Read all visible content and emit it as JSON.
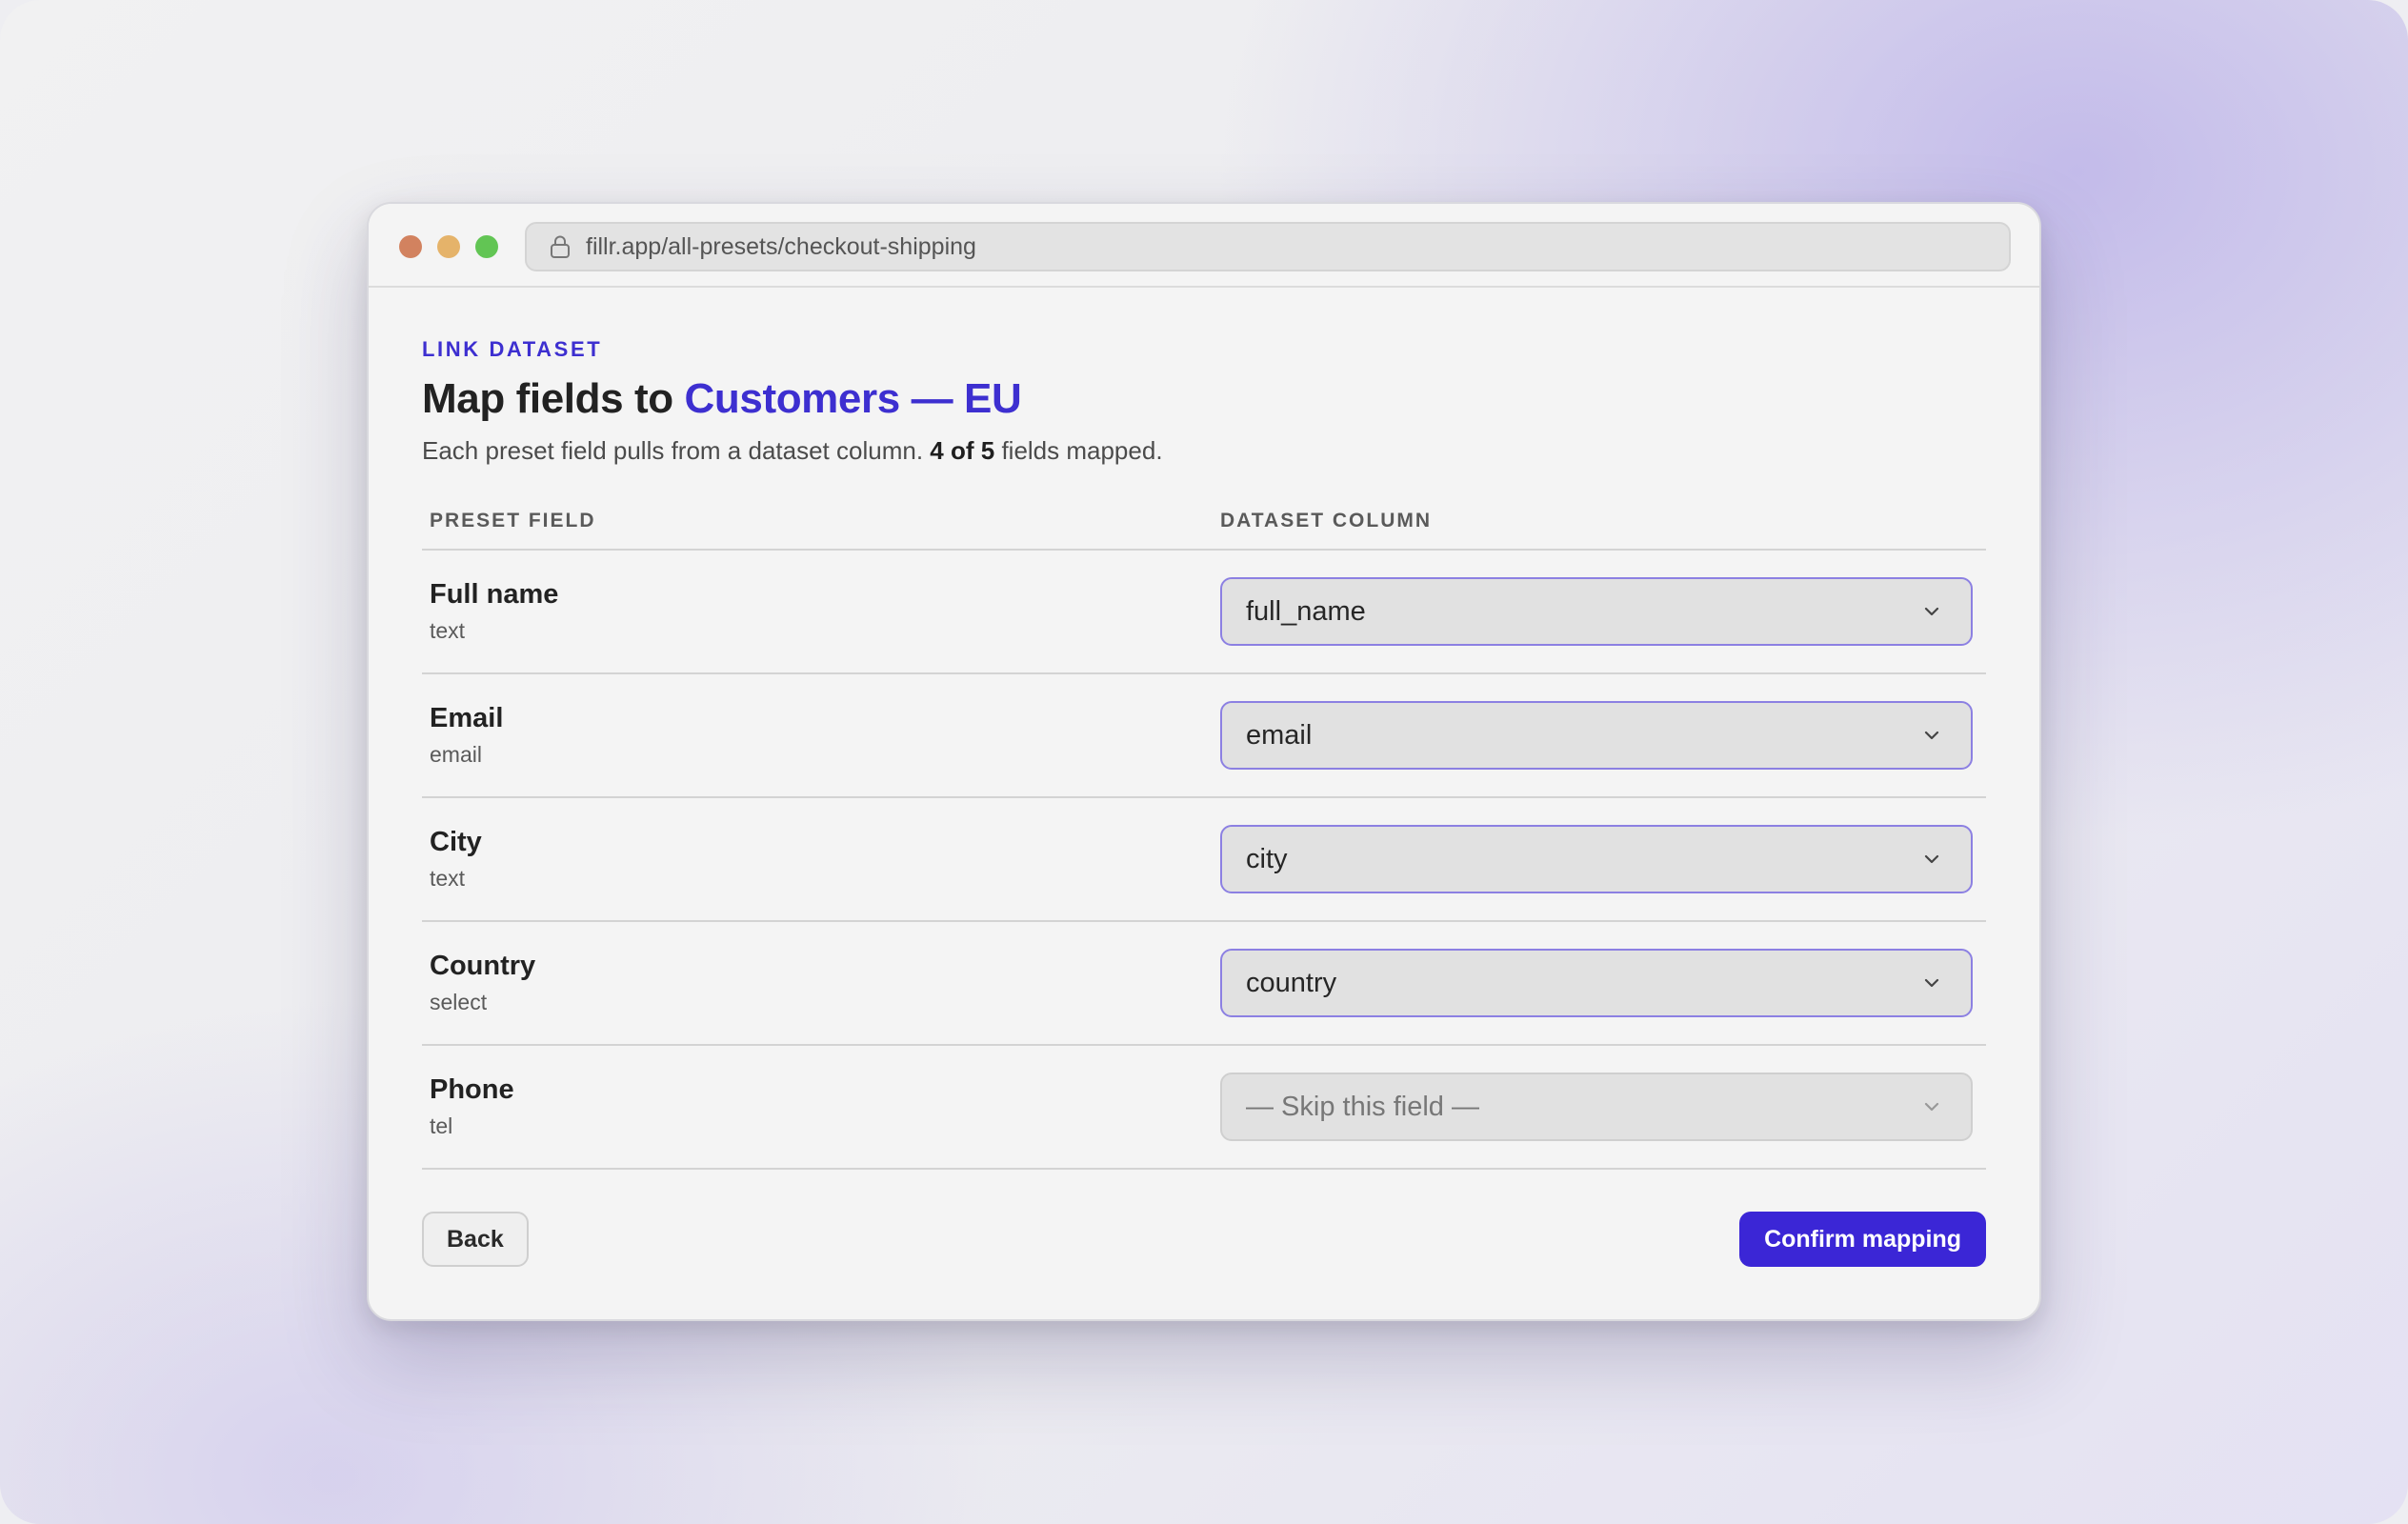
{
  "browser": {
    "url": "fillr.app/all-presets/checkout-shipping",
    "icon": "lock-icon"
  },
  "page": {
    "eyebrow": "LINK DATASET",
    "title_prefix": "Map fields to",
    "dataset_name": "Customers — EU",
    "subtitle_prefix": "Each preset field pulls from a dataset column.",
    "mapped_count": "4 of 5",
    "subtitle_suffix": "fields mapped."
  },
  "table": {
    "headers": [
      "PRESET FIELD",
      "DATASET COLUMN"
    ],
    "rows": [
      {
        "field": "Full name",
        "type": "text",
        "column": "full_name"
      },
      {
        "field": "Email",
        "type": "email",
        "column": "email"
      },
      {
        "field": "City",
        "type": "text",
        "column": "city"
      },
      {
        "field": "Country",
        "type": "select",
        "column": "country"
      },
      {
        "field": "Phone",
        "type": "tel",
        "column": "— Skip this field —"
      }
    ]
  },
  "footer": {
    "back_label": "Back",
    "confirm_label": "Confirm mapping"
  },
  "colors": {
    "accent": "#3d2fd0",
    "button_primary": "#3b26d6",
    "select_border": "#8c80e2"
  }
}
